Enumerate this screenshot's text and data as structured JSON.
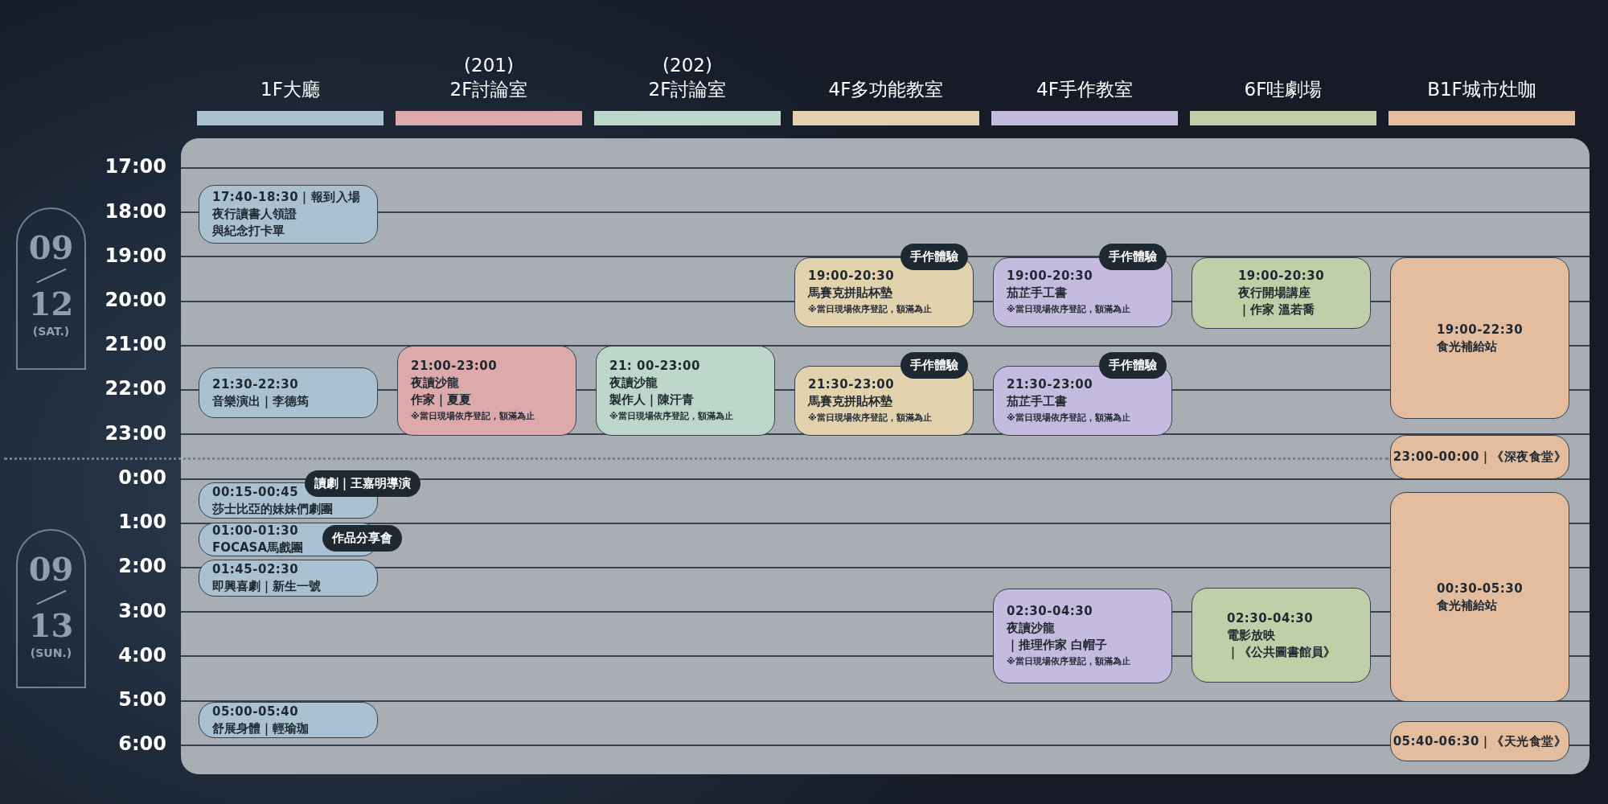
{
  "columns": [
    {
      "header": [
        "1F大廳"
      ],
      "color": "#a9c1d0",
      "events": [
        {
          "lines": [
            "17:40-18:30｜報到入場",
            "夜行讀書人領證",
            "與紀念打卡單"
          ]
        },
        {
          "lines": [
            "21:30-22:30",
            "音樂演出｜李德筠"
          ]
        },
        {
          "lines": [
            "00:15-00:45",
            "莎士比亞的妹妹們劇團"
          ],
          "tag": "讀劇｜王嘉明導演"
        },
        {
          "lines": [
            "01:00-01:30",
            "FOCASA馬戲團"
          ],
          "tag": "作品分享會"
        },
        {
          "lines": [
            "01:45-02:30",
            "即興喜劇｜新生一號"
          ]
        },
        {
          "lines": [
            "05:00-05:40",
            "舒展身體｜輕瑜珈"
          ]
        }
      ]
    },
    {
      "header": [
        "(201)",
        "2F討論室"
      ],
      "color": "#dcaaab",
      "events": [
        {
          "lines": [
            "21:00-23:00",
            "夜讀沙龍",
            "作家｜夏夏"
          ],
          "note": "※當日現場依序登記，額滿為止"
        }
      ]
    },
    {
      "header": [
        "(202)",
        "2F討論室"
      ],
      "color": "#bdd7ca",
      "events": [
        {
          "lines": [
            "21: 00-23:00",
            "夜讀沙龍",
            "製作人｜陳汗青"
          ],
          "note": "※當日現場依序登記，額滿為止"
        }
      ]
    },
    {
      "header": [
        "4F多功能教室"
      ],
      "color": "#e3d2ae",
      "events": [
        {
          "lines": [
            "19:00-20:30",
            "馬賽克拼貼杯墊"
          ],
          "note": "※當日現場依序登記，額滿為止",
          "tag": "手作體驗"
        },
        {
          "lines": [
            "21:30-23:00",
            "馬賽克拼貼杯墊"
          ],
          "note": "※當日現場依序登記，額滿為止",
          "tag": "手作體驗"
        }
      ]
    },
    {
      "header": [
        "4F手作教室"
      ],
      "color": "#c5bbdf",
      "events": [
        {
          "lines": [
            "19:00-20:30",
            "茄芷手工書"
          ],
          "note": "※當日現場依序登記，額滿為止",
          "tag": "手作體驗"
        },
        {
          "lines": [
            "21:30-23:00",
            "茄芷手工書"
          ],
          "note": "※當日現場依序登記，額滿為止",
          "tag": "手作體驗"
        },
        {
          "lines": [
            "02:30-04:30",
            "夜讀沙龍",
            "｜推理作家 白帽子"
          ],
          "note": "※當日現場依序登記，額滿為止"
        }
      ]
    },
    {
      "header": [
        "6F哇劇場"
      ],
      "color": "#c1cfa9",
      "events": [
        {
          "lines": [
            "19:00-20:30",
            "夜行開場講座",
            "｜作家 溫若喬"
          ]
        },
        {
          "lines": [
            "02:30-04:30",
            "電影放映",
            "｜《公共圖書館員》"
          ]
        }
      ]
    },
    {
      "header": [
        "B1F城市灶咖"
      ],
      "color": "#e3bd9d",
      "events": [
        {
          "lines": [
            "19:00-22:30",
            "食光補給站"
          ]
        },
        {
          "lines": [
            "23:00-00:00｜《深夜食堂》"
          ]
        },
        {
          "lines": [
            "00:30-05:30",
            "食光補給站"
          ]
        },
        {
          "lines": [
            "05:40-06:30｜《天光食堂》"
          ]
        }
      ]
    }
  ],
  "time_axis": [
    "17:00",
    "18:00",
    "19:00",
    "20:00",
    "21:00",
    "22:00",
    "23:00",
    "0:00",
    "1:00",
    "2:00",
    "3:00",
    "4:00",
    "5:00",
    "6:00"
  ],
  "dates": [
    {
      "month": "09",
      "day": "12",
      "weekday": "(SAT.)"
    },
    {
      "month": "09",
      "day": "13",
      "weekday": "(SUN.)"
    }
  ]
}
